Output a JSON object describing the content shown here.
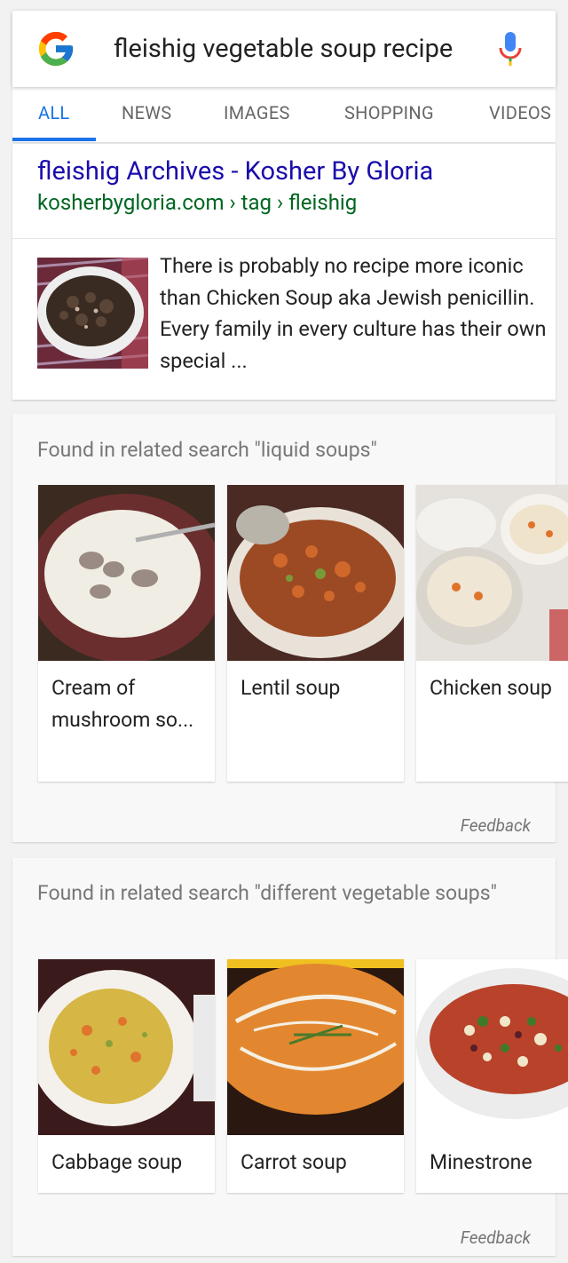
{
  "search": {
    "query": "fleishig vegetable soup recipe",
    "logo_icon": "google-g-logo",
    "mic_icon": "microphone-icon"
  },
  "tabs": [
    {
      "label": "ALL",
      "active": true
    },
    {
      "label": "NEWS",
      "active": false
    },
    {
      "label": "IMAGES",
      "active": false
    },
    {
      "label": "SHOPPING",
      "active": false
    },
    {
      "label": "VIDEOS",
      "active": false
    }
  ],
  "result": {
    "title": "fleishig Archives - Kosher By Gloria",
    "url": "kosherbygloria.com › tag › fleishig",
    "snippet": "There is probably no recipe more iconic than Chicken Soup aka Jewish penicillin. Every family in every culture has their own special ..."
  },
  "related": [
    {
      "heading": "Found in related search \"liquid soups\"",
      "items": [
        {
          "label": "Cream of mushroom so...",
          "image": "cream-of-mushroom-soup"
        },
        {
          "label": "Lentil soup",
          "image": "lentil-soup"
        },
        {
          "label": "Chicken soup",
          "image": "chicken-soup"
        }
      ],
      "feedback": "Feedback"
    },
    {
      "heading": "Found in related search \"different vegetable soups\"",
      "items": [
        {
          "label": "Cabbage soup",
          "image": "cabbage-soup"
        },
        {
          "label": "Carrot soup",
          "image": "carrot-soup"
        },
        {
          "label": "Minestrone",
          "image": "minestrone-soup"
        }
      ],
      "feedback": "Feedback"
    }
  ],
  "colors": {
    "link": "#1a0dab",
    "url": "#006621",
    "accent": "#1a73e8"
  }
}
